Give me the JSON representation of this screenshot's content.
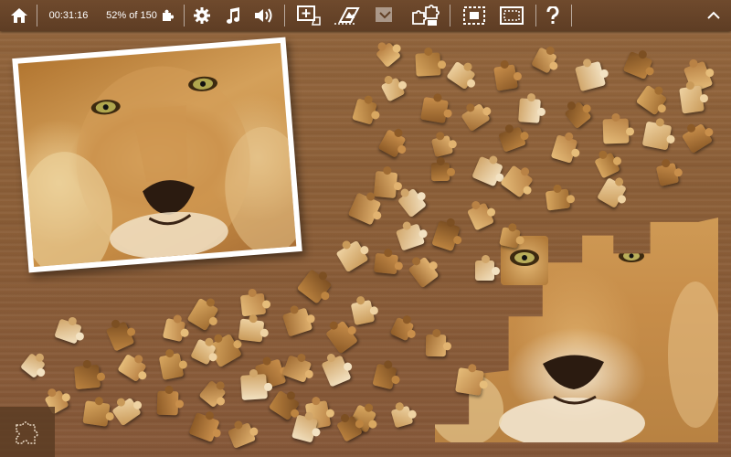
{
  "toolbar": {
    "timer": "00:31:16",
    "progress_text": "52% of 150",
    "icons": [
      "home-icon",
      "puzzle-piece-icon",
      "gear-icon",
      "music-note-icon",
      "speaker-icon",
      "add-frame-icon",
      "ghost-image-icon",
      "box-icon",
      "sort-pieces-icon",
      "edge-pieces-icon",
      "border-frame-icon",
      "help-icon",
      "chevron-up-icon"
    ]
  },
  "puzzle": {
    "total_pieces": 150,
    "completion_percent": 52
  },
  "colors": {
    "toolbar": "#5e3d24",
    "wood": "#8d6039",
    "piece_light": "#e0b36e",
    "piece_dark": "#9a6a33"
  }
}
